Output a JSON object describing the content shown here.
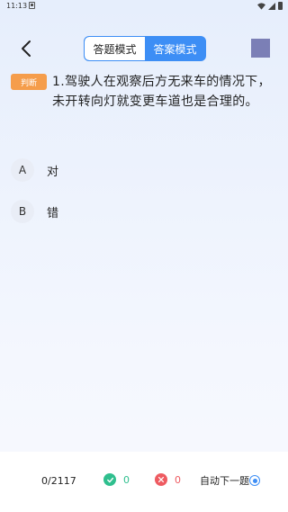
{
  "status_bar": {
    "time": "11:13"
  },
  "header": {
    "mode_tabs": [
      {
        "label": "答题模式",
        "active": true
      },
      {
        "label": "答案模式",
        "active": false
      }
    ],
    "accent_color": "#3d8ef5"
  },
  "question": {
    "type_tag": "判断",
    "text": "1.驾驶人在观察后方无来车的情况下，未开转向灯就变更车道也是合理的。"
  },
  "options": [
    {
      "letter": "A",
      "text": "对"
    },
    {
      "letter": "B",
      "text": "错"
    }
  ],
  "bottom_bar": {
    "progress": "0/2117",
    "correct_count": "0",
    "wrong_count": "0",
    "auto_next_label": "自动下一题",
    "auto_next_on": true
  }
}
